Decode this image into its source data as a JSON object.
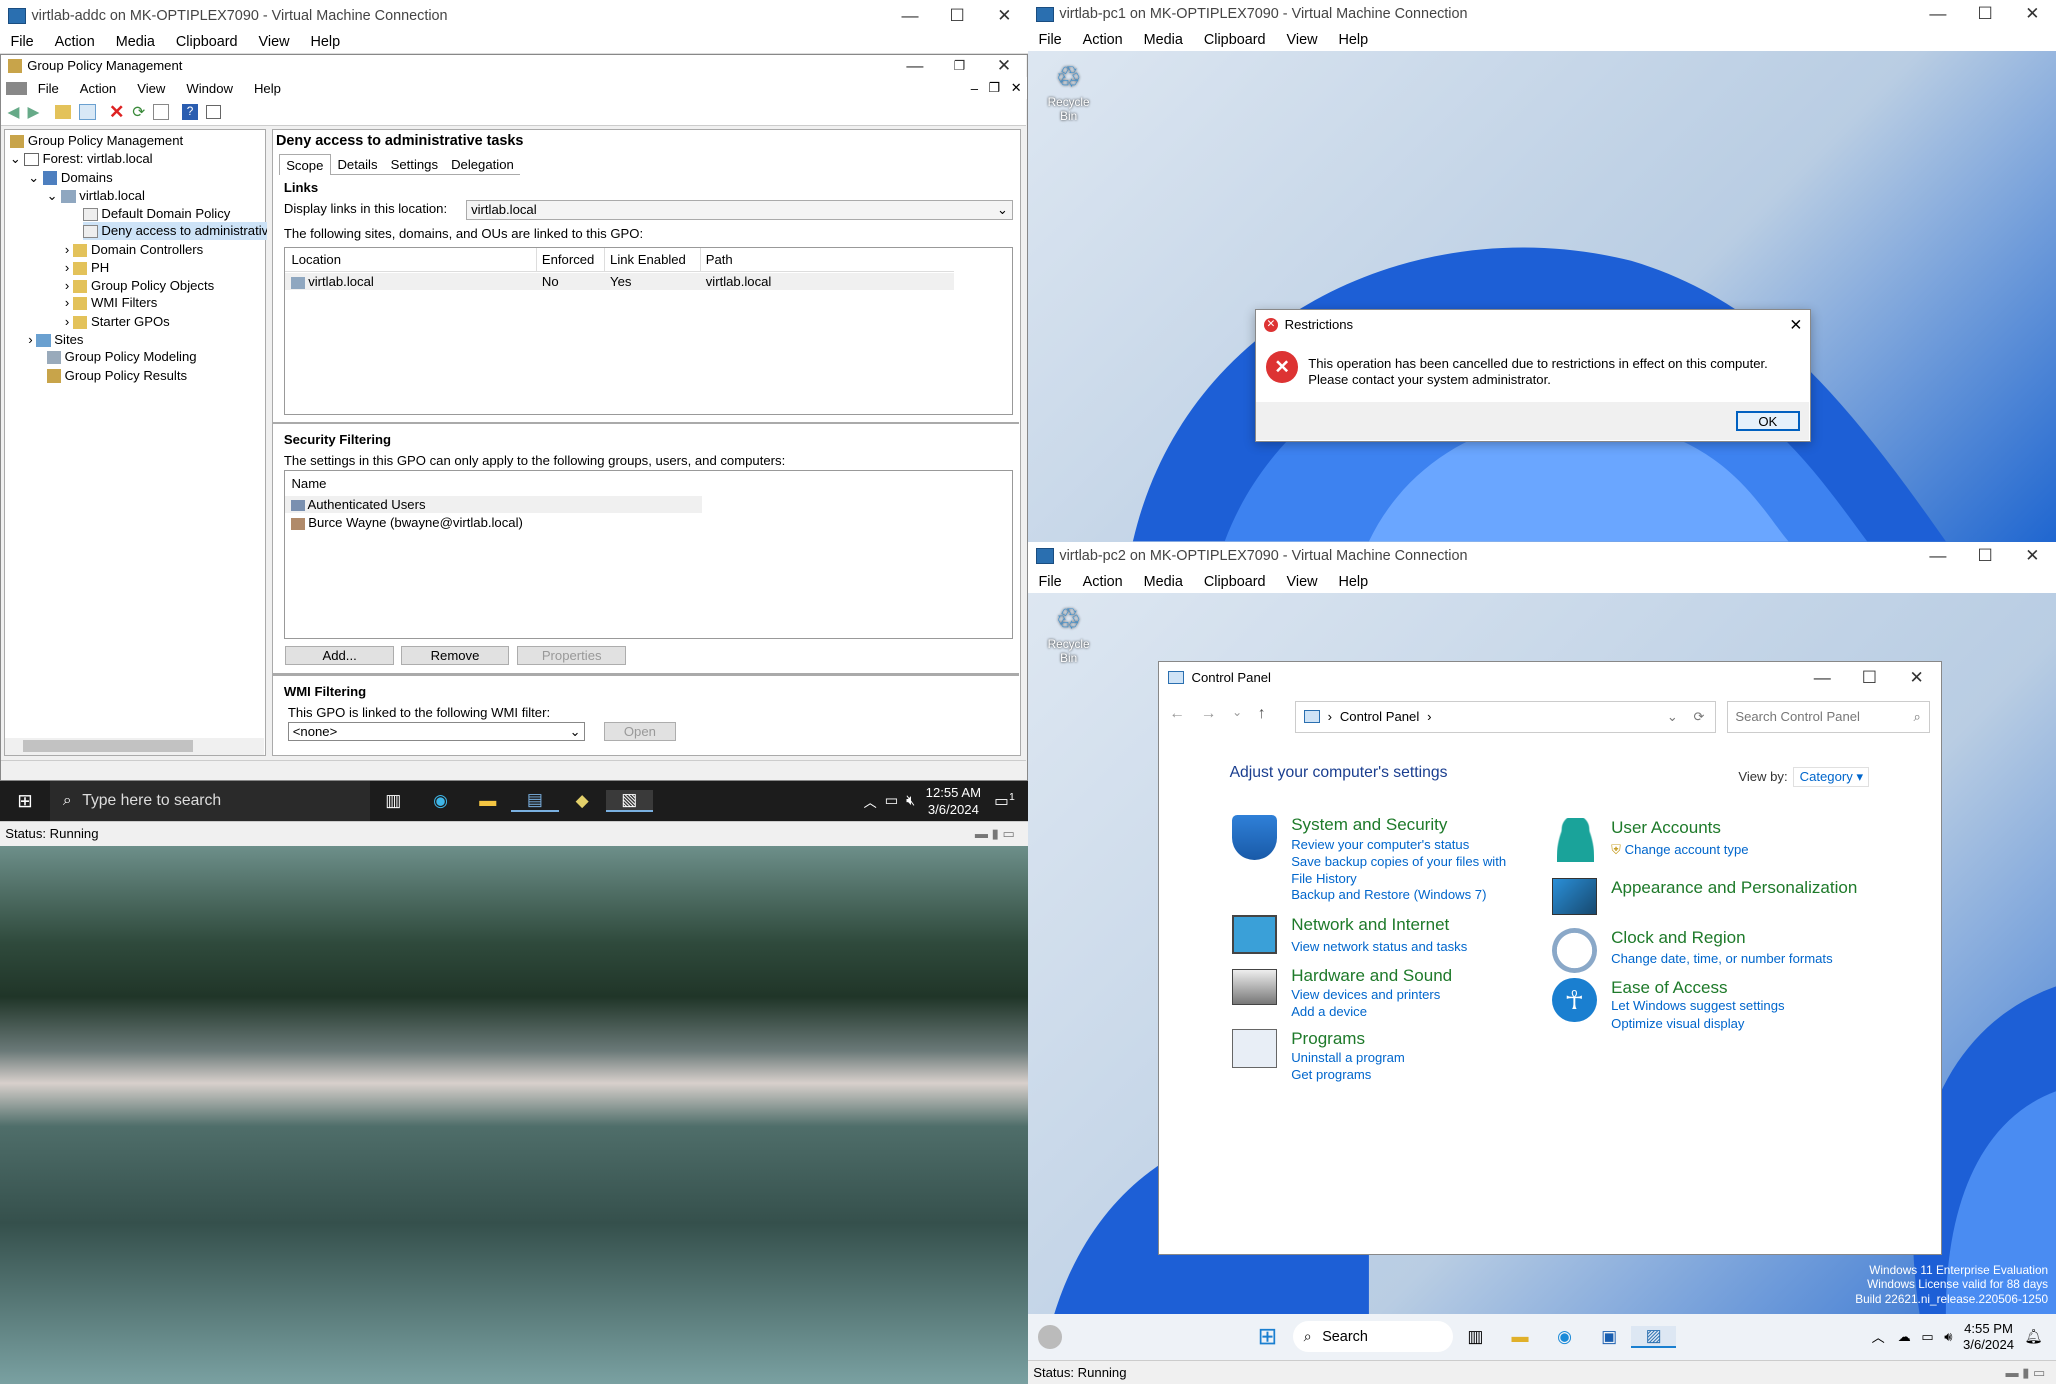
{
  "vm_addc": {
    "title": "virtlab-addc on MK-OPTIPLEX7090 - Virtual Machine Connection",
    "menu": [
      "File",
      "Action",
      "Media",
      "Clipboard",
      "View",
      "Help"
    ],
    "status": "Status: Running"
  },
  "gpm": {
    "title": "Group Policy Management",
    "menu": [
      "File",
      "Action",
      "View",
      "Window",
      "Help"
    ],
    "tree": {
      "root": "Group Policy Management",
      "forest": "Forest: virtlab.local",
      "domains": "Domains",
      "domain": "virtlab.local",
      "ddp": "Default Domain Policy",
      "deny": "Deny access to administrative t",
      "dc": "Domain Controllers",
      "ph": "PH",
      "gpo": "Group Policy Objects",
      "wmi": "WMI Filters",
      "starter": "Starter GPOs",
      "sites": "Sites",
      "modeling": "Group Policy Modeling",
      "results": "Group Policy Results"
    },
    "gpo_title": "Deny access to administrative tasks",
    "tabs": [
      "Scope",
      "Details",
      "Settings",
      "Delegation"
    ],
    "links_heading": "Links",
    "display_label": "Display links in this location:",
    "display_value": "virtlab.local",
    "links_desc": "The following sites, domains, and OUs are linked to this GPO:",
    "links_cols": [
      "Location",
      "Enforced",
      "Link Enabled",
      "Path"
    ],
    "links_row": [
      "virtlab.local",
      "No",
      "Yes",
      "virtlab.local"
    ],
    "sec_heading": "Security Filtering",
    "sec_desc": "The settings in this GPO can only apply to the following groups, users, and computers:",
    "sec_col": "Name",
    "sec_rows": [
      "Authenticated Users",
      "Burce Wayne (bwayne@virtlab.local)"
    ],
    "add": "Add...",
    "remove": "Remove",
    "properties": "Properties",
    "wmi_heading": "WMI Filtering",
    "wmi_desc": "This GPO is linked to the following WMI filter:",
    "wmi_value": "<none>",
    "open": "Open"
  },
  "taskbar_addc": {
    "search": "Type here to search",
    "time": "12:55 AM",
    "date": "3/6/2024",
    "notif": "1"
  },
  "vm_pc1": {
    "title": "virtlab-pc1 on MK-OPTIPLEX7090 - Virtual Machine Connection",
    "menu": [
      "File",
      "Action",
      "Media",
      "Clipboard",
      "View",
      "Help"
    ],
    "recycle": "Recycle Bin"
  },
  "dialog": {
    "title": "Restrictions",
    "message": "This operation has been cancelled due to restrictions in effect on this computer. Please contact your system administrator.",
    "ok": "OK"
  },
  "vm_pc2": {
    "title": "virtlab-pc2 on MK-OPTIPLEX7090 - Virtual Machine Connection",
    "menu": [
      "File",
      "Action",
      "Media",
      "Clipboard",
      "View",
      "Help"
    ],
    "recycle": "Recycle Bin",
    "status": "Status: Running"
  },
  "cp": {
    "title": "Control Panel",
    "crumb": "Control Panel",
    "search_placeholder": "Search Control Panel",
    "heading": "Adjust your computer's settings",
    "viewby": "View by:",
    "viewby_value": "Category",
    "left": [
      {
        "name": "System and Security",
        "links": [
          "Review your computer's status",
          "Save backup copies of your files with File History",
          "Backup and Restore (Windows 7)"
        ]
      },
      {
        "name": "Network and Internet",
        "links": [
          "View network status and tasks"
        ]
      },
      {
        "name": "Hardware and Sound",
        "links": [
          "View devices and printers",
          "Add a device"
        ]
      },
      {
        "name": "Programs",
        "links": [
          "Uninstall a program",
          "Get programs"
        ]
      }
    ],
    "right": [
      {
        "name": "User Accounts",
        "links": [
          "Change account type"
        ]
      },
      {
        "name": "Appearance and Personalization",
        "links": []
      },
      {
        "name": "Clock and Region",
        "links": [
          "Change date, time, or number formats"
        ]
      },
      {
        "name": "Ease of Access",
        "links": [
          "Let Windows suggest settings",
          "Optimize visual display"
        ]
      }
    ]
  },
  "watermark": {
    "line1": "Windows 11 Enterprise Evaluation",
    "line2": "Windows License valid for 88 days",
    "line3": "Build 22621.ni_release.220506-1250"
  },
  "taskbar_pc2": {
    "search": "Search",
    "time": "4:55 PM",
    "date": "3/6/2024"
  }
}
